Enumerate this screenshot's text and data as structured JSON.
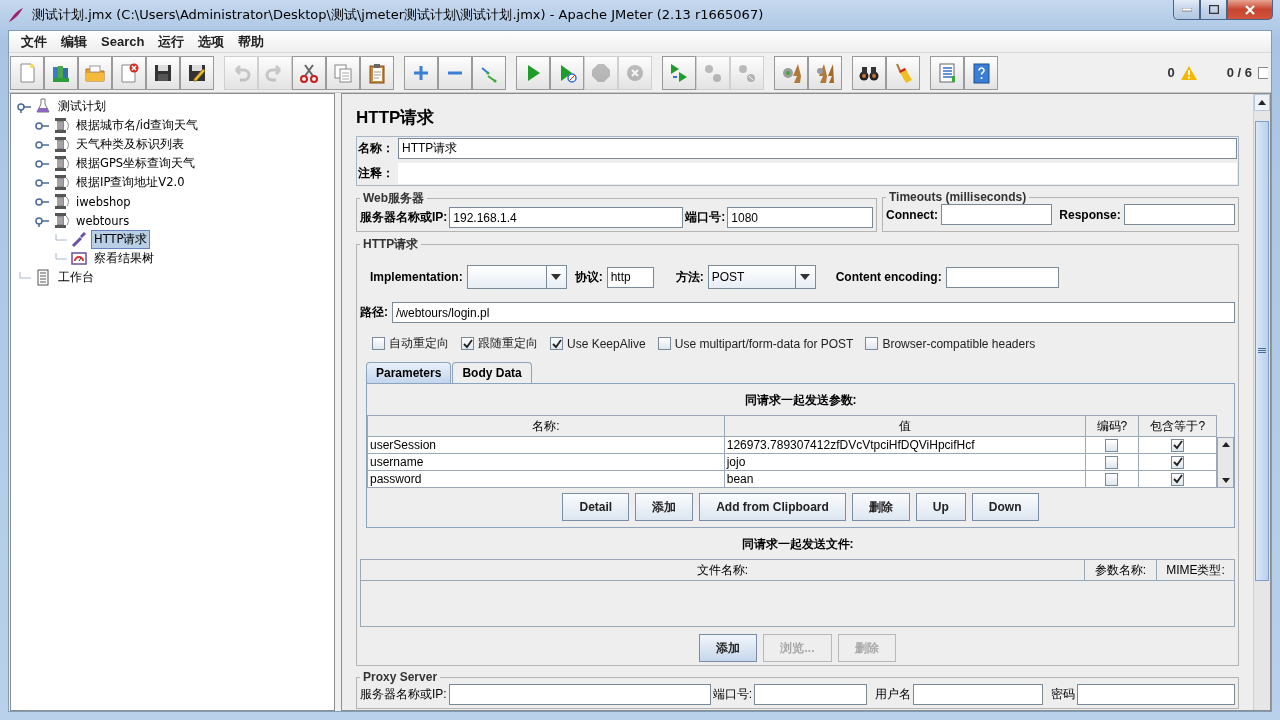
{
  "window": {
    "title": "测试计划.jmx (C:\\Users\\Administrator\\Desktop\\测试\\jmeter测试计划\\测试计划.jmx) - Apache JMeter (2.13 r1665067)"
  },
  "menu": [
    "文件",
    "编辑",
    "Search",
    "运行",
    "选项",
    "帮助"
  ],
  "toolbar": [
    [
      {
        "kind": "new",
        "disabled": false
      },
      {
        "kind": "templates",
        "disabled": false
      },
      {
        "kind": "open",
        "disabled": false
      },
      {
        "kind": "close",
        "disabled": false
      },
      {
        "kind": "save",
        "disabled": false
      },
      {
        "kind": "save-image",
        "disabled": false
      }
    ],
    [
      {
        "kind": "undo",
        "disabled": true
      },
      {
        "kind": "redo",
        "disabled": true
      },
      {
        "kind": "cut",
        "disabled": false
      },
      {
        "kind": "copy",
        "disabled": false
      },
      {
        "kind": "paste",
        "disabled": false
      }
    ],
    [
      {
        "kind": "expand",
        "disabled": false
      },
      {
        "kind": "collapse",
        "disabled": false
      },
      {
        "kind": "toggle",
        "disabled": false
      }
    ],
    [
      {
        "kind": "start",
        "disabled": false
      },
      {
        "kind": "start-no-timers",
        "disabled": false
      },
      {
        "kind": "stop",
        "disabled": true
      },
      {
        "kind": "shutdown",
        "disabled": true
      }
    ],
    [
      {
        "kind": "remote-start",
        "disabled": false
      },
      {
        "kind": "remote-stop",
        "disabled": true
      },
      {
        "kind": "remote-shutdown",
        "disabled": true
      }
    ],
    [
      {
        "kind": "clear",
        "disabled": false
      },
      {
        "kind": "clear-all",
        "disabled": false
      }
    ],
    [
      {
        "kind": "search",
        "disabled": false
      },
      {
        "kind": "reset-search",
        "disabled": false
      }
    ],
    [
      {
        "kind": "functions",
        "disabled": false
      },
      {
        "kind": "help",
        "disabled": false
      }
    ]
  ],
  "status": {
    "warnings": "0",
    "threads": "0 / 6"
  },
  "tree": [
    {
      "label": "测试计划",
      "kind": "plan",
      "selected": false,
      "expanded": true,
      "children": [
        {
          "label": "根据城市名/id查询天气",
          "kind": "thread-group",
          "selected": false,
          "expanded": false
        },
        {
          "label": "天气种类及标识列表",
          "kind": "thread-group",
          "selected": false,
          "expanded": false
        },
        {
          "label": "根据GPS坐标查询天气",
          "kind": "thread-group",
          "selected": false,
          "expanded": false
        },
        {
          "label": "根据IP查询地址V2.0",
          "kind": "thread-group",
          "selected": false,
          "expanded": false
        },
        {
          "label": "iwebshop",
          "kind": "thread-group",
          "selected": false,
          "expanded": false
        },
        {
          "label": "webtours",
          "kind": "thread-group",
          "selected": false,
          "expanded": true,
          "children": [
            {
              "label": "HTTP请求",
              "kind": "sampler",
              "selected": true
            },
            {
              "label": "察看结果树",
              "kind": "listener",
              "selected": false
            }
          ]
        }
      ]
    },
    {
      "label": "工作台",
      "kind": "workbench",
      "selected": false
    }
  ],
  "panel": {
    "title": "HTTP请求",
    "name_label": "名称：",
    "name_value": "HTTP请求",
    "comment_label": "注释：",
    "web_server": {
      "legend": "Web服务器",
      "server_label": "服务器名称或IP:",
      "server_value": "192.168.1.4",
      "port_label": "端口号:",
      "port_value": "1080"
    },
    "timeouts": {
      "legend": "Timeouts (milliseconds)",
      "connect_label": "Connect:",
      "response_label": "Response:"
    },
    "http": {
      "legend": "HTTP请求",
      "implementation_label": "Implementation:",
      "protocol_label": "协议:",
      "protocol_value": "http",
      "method_label": "方法:",
      "method_value": "POST",
      "encoding_label": "Content encoding:",
      "path_label": "路径:",
      "path_value": "/webtours/login.pl",
      "options": [
        {
          "label": "自动重定向",
          "checked": false
        },
        {
          "label": "跟随重定向",
          "checked": true
        },
        {
          "label": "Use KeepAlive",
          "checked": true
        },
        {
          "label": "Use multipart/form-data for POST",
          "checked": false
        },
        {
          "label": "Browser-compatible headers",
          "checked": false
        }
      ]
    },
    "tabs": [
      {
        "label": "Parameters",
        "selected": true
      },
      {
        "label": "Body Data",
        "selected": false
      }
    ],
    "parameters": {
      "caption": "同请求一起发送参数:",
      "columns": [
        "名称:",
        "值",
        "编码?",
        "包含等于?"
      ],
      "rows": [
        {
          "name": "userSession",
          "value": "126973.789307412zfDVcVtpciHfDQViHpcifHcf",
          "encode": false,
          "include_equals": true
        },
        {
          "name": "username",
          "value": "jojo",
          "encode": false,
          "include_equals": true
        },
        {
          "name": "password",
          "value": "bean",
          "encode": false,
          "include_equals": true
        }
      ],
      "buttons": [
        "Detail",
        "添加",
        "Add from Clipboard",
        "删除",
        "Up",
        "Down"
      ]
    },
    "files": {
      "caption": "同请求一起发送文件:",
      "columns": [
        "文件名称:",
        "参数名称:",
        "MIME类型:"
      ],
      "buttons": [
        {
          "label": "添加",
          "disabled": false
        },
        {
          "label": "浏览...",
          "disabled": true
        },
        {
          "label": "删除",
          "disabled": true
        }
      ]
    },
    "proxy": {
      "legend": "Proxy Server",
      "server_label": "服务器名称或IP:",
      "port_label": "端口号:",
      "user_label": "用户名",
      "password_label": "密码"
    }
  }
}
